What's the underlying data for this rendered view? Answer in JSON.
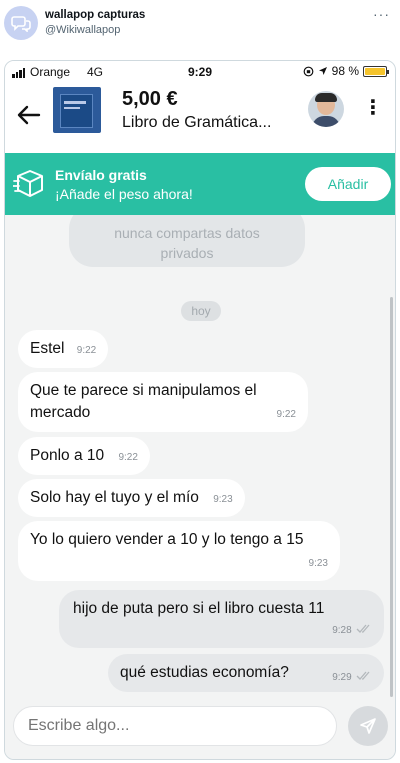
{
  "tweet": {
    "name": "wallapop capturas",
    "handle": "@Wikiwallapop",
    "more": "···"
  },
  "status_bar": {
    "carrier": "Orange",
    "network": "4G",
    "time": "9:29",
    "battery": "98 %",
    "battery_level": 0.98
  },
  "listing": {
    "price": "5,00 €",
    "title": "Libro de Gramática..."
  },
  "promo": {
    "title": "Envíalo gratis",
    "subtitle": "¡Añade el peso ahora!",
    "button": "Añadir",
    "color": "#29bfa3"
  },
  "notice": {
    "line1": "nunca compartas datos",
    "line2": "privados"
  },
  "day_label": "hoy",
  "messages": [
    {
      "text": "Estel",
      "time": "9:22",
      "dir": "in"
    },
    {
      "text": "Que te parece si manipulamos el mercado",
      "time": "9:22",
      "dir": "in"
    },
    {
      "text": "Ponlo a 10",
      "time": "9:22",
      "dir": "in"
    },
    {
      "text": "Solo hay el tuyo y el mío",
      "time": "9:23",
      "dir": "in"
    },
    {
      "text": "Yo lo quiero vender a 10 y lo tengo a 15",
      "time": "9:23",
      "dir": "in"
    },
    {
      "text": "hijo de puta pero si el libro cuesta 11",
      "time": "9:28",
      "dir": "out"
    },
    {
      "text": "qué estudias economía?",
      "time": "9:29",
      "dir": "out"
    }
  ],
  "composer": {
    "placeholder": "Escribe algo..."
  },
  "icons": {
    "back": "arrow-left-icon",
    "menu": "kebab-icon",
    "box": "box-icon",
    "send": "send-icon",
    "read": "double-check-icon"
  }
}
